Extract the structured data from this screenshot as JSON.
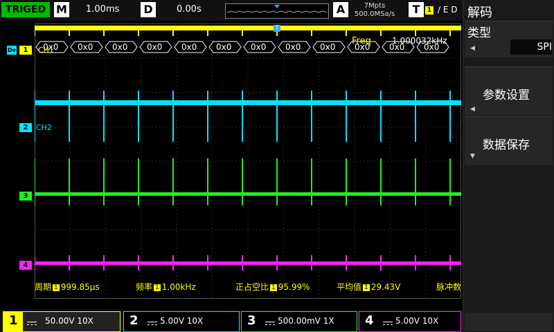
{
  "top": {
    "trigger_status": "TRIGED",
    "m_label": "M",
    "m_value": "1.00ms",
    "d_label": "D",
    "d_value": "0.00s",
    "a_label": "A",
    "mem_depth": "7Mpts",
    "sample_rate": "500.0MSa/s",
    "t_label": "T",
    "trig_source": "1",
    "trig_edge_text": "/ E D"
  },
  "sidebar": {
    "title": "解码",
    "type_label": "类型",
    "type_value": "SPI",
    "params_label": "参数设置",
    "save_label": "数据保存"
  },
  "decode": {
    "tag": "De",
    "bytes": [
      "0x0",
      "0x0",
      "0x0",
      "0x0",
      "0x0",
      "0x0",
      "0x0",
      "0x0",
      "0x0",
      "0x0",
      "0x0",
      "0x0"
    ],
    "freq_label": "Freq",
    "freq_value": "1.000032kHz"
  },
  "channels": {
    "ch1_name": "CH1",
    "ch2_name": "CH2",
    "tags": [
      "1",
      "2",
      "3",
      "4"
    ],
    "colors": {
      "ch1": "#ffff00",
      "ch2": "#00e5ff",
      "ch3": "#22ee22",
      "ch4": "#ff22ff"
    }
  },
  "measurements": {
    "period_label": "周期",
    "period_value": "999.85μs",
    "freq_label": "频率",
    "freq_value": "1.00kHz",
    "duty_label": "正占空比",
    "duty_value": "95.99%",
    "avg_label": "平均值",
    "avg_value": "29.43V",
    "pulse_label": "脉冲数",
    "badge": "1"
  },
  "bottom": {
    "ch": [
      {
        "num": "1",
        "scale": "50.00V 10X"
      },
      {
        "num": "2",
        "scale": "5.00V 10X"
      },
      {
        "num": "3",
        "scale": "500.00mV 1X"
      },
      {
        "num": "4",
        "scale": "5.00V 10X"
      }
    ]
  }
}
